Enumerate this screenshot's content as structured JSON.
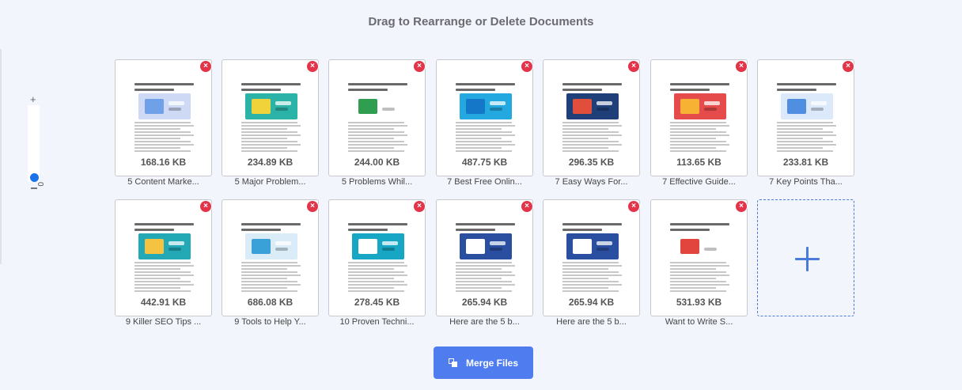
{
  "header": {
    "title": "Drag to Rearrange or Delete Documents"
  },
  "zoom": {
    "plus_label": "+",
    "value": "0"
  },
  "files": [
    {
      "name": "5 Content Marke...",
      "size": "168.16 KB",
      "art": [
        "#cdd9f5",
        "#6fa0e8"
      ]
    },
    {
      "name": "5 Major Problem...",
      "size": "234.89 KB",
      "art": [
        "#2bb3a8",
        "#f0d23a"
      ]
    },
    {
      "name": "5 Problems Whil...",
      "size": "244.00 KB",
      "art": [
        "#ffffff",
        "#2f9e50"
      ]
    },
    {
      "name": "7 Best Free Onlin...",
      "size": "487.75 KB",
      "art": [
        "#24a8e0",
        "#1577c8"
      ]
    },
    {
      "name": "7 Easy Ways For...",
      "size": "296.35 KB",
      "art": [
        "#1f3f78",
        "#e14f3c"
      ]
    },
    {
      "name": "7 Effective Guide...",
      "size": "113.65 KB",
      "art": [
        "#e64b4b",
        "#f7b234"
      ]
    },
    {
      "name": "7 Key Points Tha...",
      "size": "233.81 KB",
      "art": [
        "#dbe9fb",
        "#4f8ee0"
      ]
    },
    {
      "name": "9 Killer SEO Tips ...",
      "size": "442.91 KB",
      "art": [
        "#23a9b6",
        "#f5c342"
      ]
    },
    {
      "name": "9 Tools to Help Y...",
      "size": "686.08 KB",
      "art": [
        "#d9ecf8",
        "#3aa1d8"
      ]
    },
    {
      "name": "10 Proven Techni...",
      "size": "278.45 KB",
      "art": [
        "#17a7c4",
        "#ffffff"
      ]
    },
    {
      "name": "Here are the 5 b...",
      "size": "265.94 KB",
      "art": [
        "#2b4fa0",
        "#ffffff"
      ]
    },
    {
      "name": "Here are the 5 b...",
      "size": "265.94 KB",
      "art": [
        "#2b4fa0",
        "#ffffff"
      ]
    },
    {
      "name": "Want to Write S...",
      "size": "531.93 KB",
      "art": [
        "#ffffff",
        "#e2443e"
      ]
    }
  ],
  "actions": {
    "merge_label": "Merge Files",
    "delete_glyph": "×"
  },
  "colors": {
    "accent": "#4f7df0",
    "delete": "#e3344a",
    "add_border": "#4a7bd8"
  }
}
